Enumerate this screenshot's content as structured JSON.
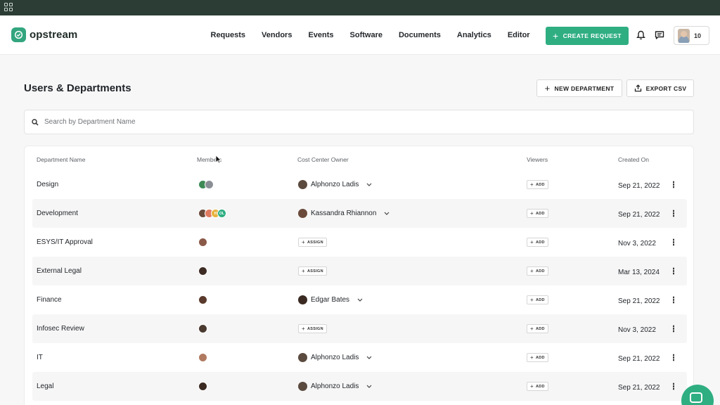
{
  "app": {
    "name": "opstream"
  },
  "nav": {
    "items": [
      {
        "label": "Requests"
      },
      {
        "label": "Vendors"
      },
      {
        "label": "Events"
      },
      {
        "label": "Software"
      },
      {
        "label": "Documents"
      },
      {
        "label": "Analytics"
      },
      {
        "label": "Editor"
      }
    ]
  },
  "header": {
    "create_label": "CREATE REQUEST",
    "user_count": "10"
  },
  "page": {
    "title": "Users & Departments",
    "new_department_label": "NEW DEPARTMENT",
    "export_label": "EXPORT CSV"
  },
  "search": {
    "placeholder": "Search by Department Name",
    "value": ""
  },
  "table": {
    "columns": [
      "Department Name",
      "Members",
      "Cost Center Owner",
      "Viewers",
      "Created On"
    ],
    "assign_label": "ASSIGN",
    "add_label": "ADD",
    "rows": [
      {
        "name": "Design",
        "owner": "Alphonzo Ladis",
        "created": "Sep 21, 2022"
      },
      {
        "name": "Development",
        "owner": "Kassandra Rhiannon",
        "created": "Sep 21, 2022"
      },
      {
        "name": "ESYS/IT Approval",
        "owner": null,
        "created": "Nov 3, 2022"
      },
      {
        "name": "External Legal",
        "owner": null,
        "created": "Mar 13, 2024"
      },
      {
        "name": "Finance",
        "owner": "Edgar Bates",
        "created": "Sep 21, 2022"
      },
      {
        "name": "Infosec Review",
        "owner": null,
        "created": "Nov 3, 2022"
      },
      {
        "name": "IT",
        "owner": "Alphonzo Ladis",
        "created": "Sep 21, 2022"
      },
      {
        "name": "Legal",
        "owner": "Alphonzo Ladis",
        "created": "Sep 21, 2022"
      }
    ],
    "member_initials": [
      "H",
      "OL"
    ]
  },
  "colors": {
    "accent": "#2fae82",
    "topbar": "#2b3d35"
  }
}
